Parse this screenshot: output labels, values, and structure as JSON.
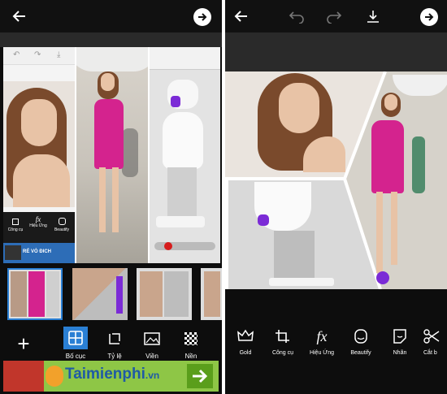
{
  "left_screen": {
    "toolbar": {
      "back_icon": "arrow-left-icon",
      "next_icon": "arrow-right-icon"
    },
    "mini_toolbar": [
      "Công cụ",
      "Hiệu Ứng",
      "Beautify"
    ],
    "ad_small_text": "RÉ VÒ ĐICH",
    "tools": [
      {
        "label": "Bố cục",
        "icon": "layout-grid-icon"
      },
      {
        "label": "Tỷ lệ",
        "icon": "ratio-icon"
      },
      {
        "label": "Viền",
        "icon": "border-image-icon"
      },
      {
        "label": "Nền",
        "icon": "background-checker-icon"
      }
    ],
    "banner": {
      "brand": "Taimienphi",
      "domain": ".vn"
    }
  },
  "right_screen": {
    "toolbar": {
      "back_icon": "arrow-left-icon",
      "undo_icon": "undo-icon",
      "redo_icon": "redo-icon",
      "save_icon": "download-icon",
      "next_icon": "arrow-right-icon"
    },
    "tools": [
      {
        "label": "Gold",
        "icon": "crown-icon"
      },
      {
        "label": "Công cụ",
        "icon": "crop-icon"
      },
      {
        "label": "Hiệu Ứng",
        "icon": "fx-icon"
      },
      {
        "label": "Beautify",
        "icon": "face-icon"
      },
      {
        "label": "Nhãn",
        "icon": "sticker-icon"
      },
      {
        "label": "Cắt b",
        "icon": "scissors-icon"
      }
    ]
  },
  "colors": {
    "accent_blue": "#2a7fd4",
    "dress_pink": "#d4238e",
    "banner_green": "#8ec646",
    "purple": "#7b2bd6"
  }
}
